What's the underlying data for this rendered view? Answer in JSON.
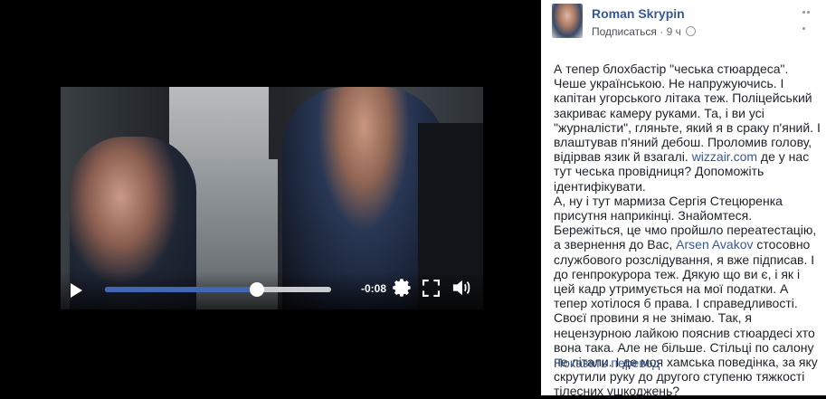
{
  "author": {
    "name": "Roman Skrypin"
  },
  "meta": {
    "follow_label": "Подписаться",
    "separator": "·",
    "time": "9 ч"
  },
  "video": {
    "time_remaining": "-0:08",
    "progress_fraction": 0.67
  },
  "icons": {
    "play": "play-icon",
    "settings": "gear-icon",
    "fullscreen": "fullscreen-icon",
    "volume": "volume-icon",
    "privacy": "globe-icon",
    "more": "more-icon"
  },
  "post": {
    "p1": "А тепер блохбастір \"чеська стюардеса\". Чеше українською. Не напружуючись. І капітан угорського літака теж. Поліцейський закриває камеру руками. Та, і ви усі \"журналісти\", гляньте, який я в сраку п'яний. І влаштував п'яний дебош. Проломив голову, відірвав язик й взагалі.",
    "link1": "wizzair.com",
    "p2": " де у нас тут чеська провідниця? Допоможіть ідентифікувати.\nА, ну і тут мармиза Сергія Стецюренка присутня наприкінці. Знайомтеся. Бережіться, це чмо пройшло переатестацію, а звернення до Вас,",
    "link2": "Arsen Avakov",
    "p3": " стосовно службового розслідування, я вже підписав. І до генпрокурора теж. Дякую що ви є, і як і цей кадр утримується на мої податки. А тепер хотілося б права. І справедливості. Своєї провини я не знімаю. Так, я нецензурною лайкою пояснив стюардесі хто вона така. Але не більше. Стільці по салону не літали. І де моя хамська поведінка, за яку скрутили руку до другого ступеню тяжкості тілесних ушкоджень?",
    "translate_label": "Показать перевод"
  }
}
